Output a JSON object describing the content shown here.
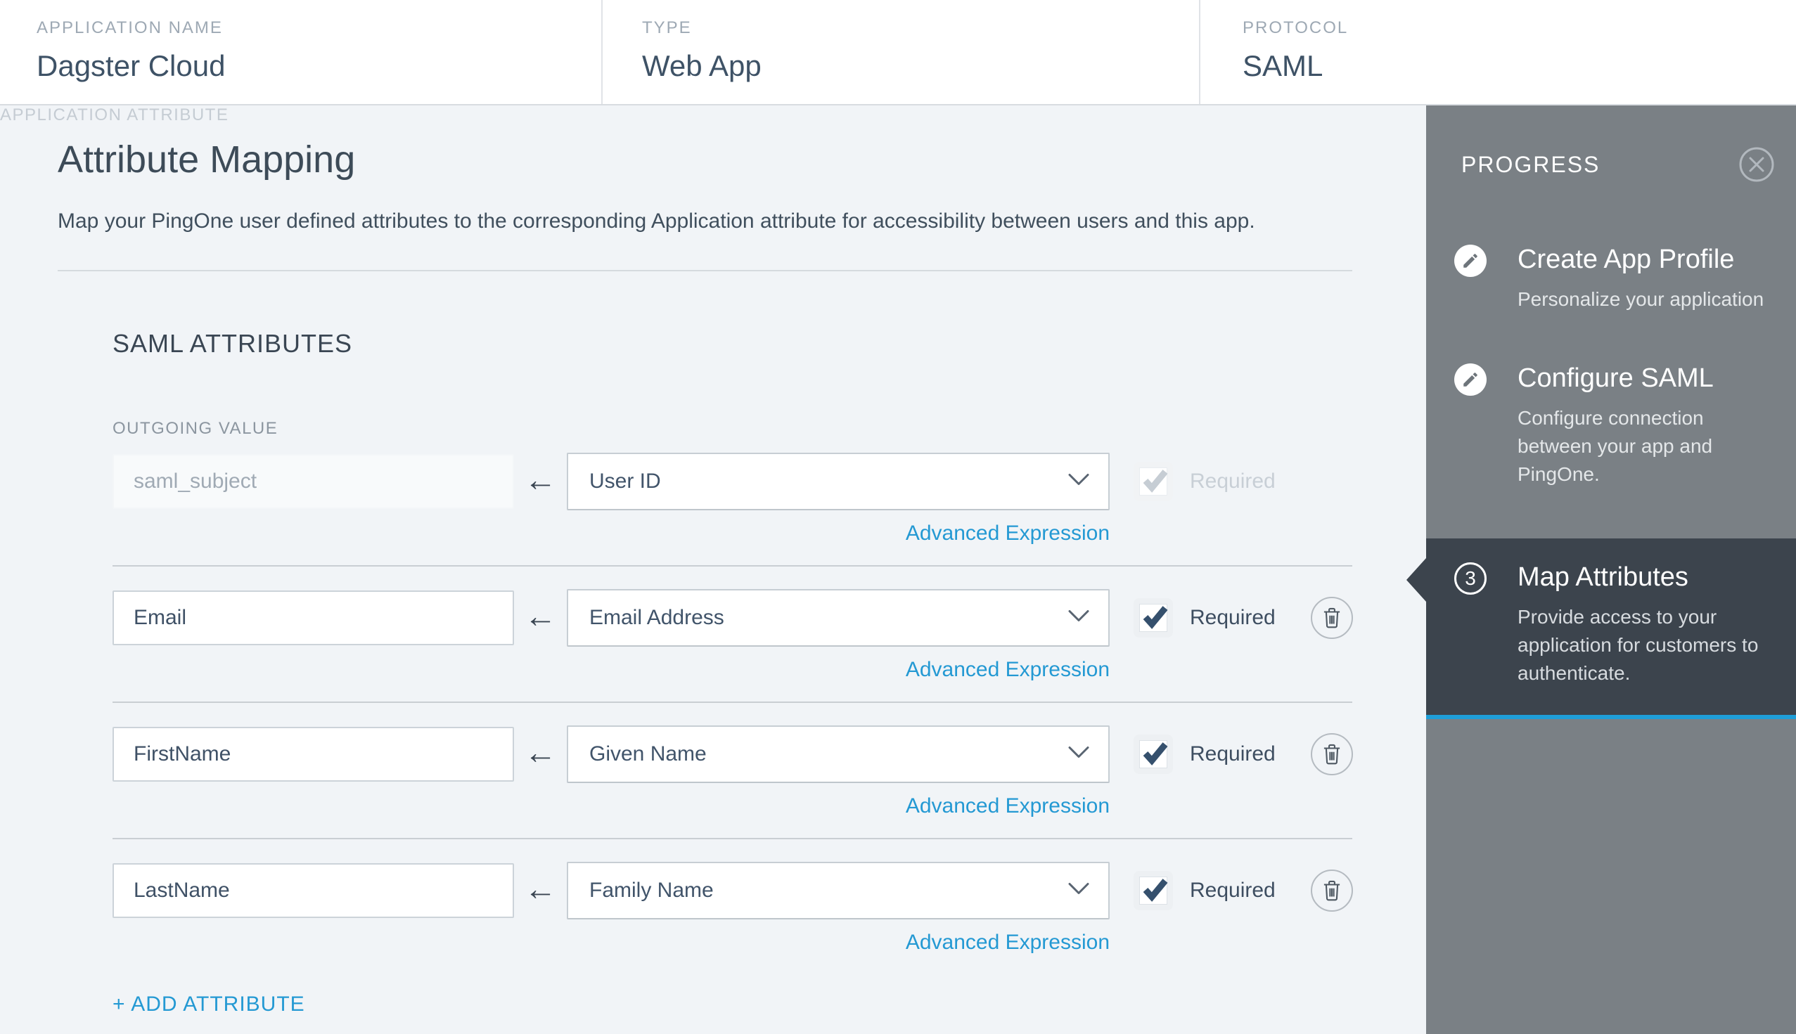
{
  "header": {
    "fields": [
      {
        "label": "APPLICATION NAME",
        "value": "Dagster Cloud"
      },
      {
        "label": "TYPE",
        "value": "Web App"
      },
      {
        "label": "PROTOCOL",
        "value": "SAML"
      }
    ]
  },
  "main": {
    "title": "Attribute Mapping",
    "description": "Map your PingOne user defined attributes to the corresponding Application attribute for accessibility between users and this app.",
    "section_title": "SAML ATTRIBUTES",
    "columns": {
      "application_attribute": "APPLICATION ATTRIBUTE",
      "outgoing_value": "OUTGOING VALUE"
    },
    "required_label": "Required",
    "advanced_expression_label": "Advanced Expression",
    "add_attribute_label": "+ ADD ATTRIBUTE",
    "rows": [
      {
        "application_attribute": "saml_subject",
        "outgoing_value": "User ID",
        "required": true,
        "disabled": true,
        "deletable": false
      },
      {
        "application_attribute": "Email",
        "outgoing_value": "Email Address",
        "required": true,
        "disabled": false,
        "deletable": true
      },
      {
        "application_attribute": "FirstName",
        "outgoing_value": "Given Name",
        "required": true,
        "disabled": false,
        "deletable": true
      },
      {
        "application_attribute": "LastName",
        "outgoing_value": "Family Name",
        "required": true,
        "disabled": false,
        "deletable": true
      }
    ]
  },
  "sidebar": {
    "title": "PROGRESS",
    "close_icon": "close-icon",
    "steps": [
      {
        "icon": "pencil-icon",
        "title": "Create App Profile",
        "description": "Personalize your application",
        "active": false
      },
      {
        "icon": "pencil-icon",
        "title": "Configure SAML",
        "description": "Configure connection between your app and PingOne.",
        "active": false
      },
      {
        "icon": "step-number-badge",
        "number": "3",
        "title": "Map Attributes",
        "description": "Provide access to your application for customers to authenticate.",
        "active": true
      }
    ]
  },
  "colors": {
    "accent_blue": "#2499d3",
    "highlight_blue": "#1e9ed8",
    "sidebar_gray": "#7a8085",
    "active_step_bg": "#3c444d",
    "check_navy": "#35506d",
    "text_dark": "#3e5266",
    "page_background": "#f1f4f7"
  }
}
